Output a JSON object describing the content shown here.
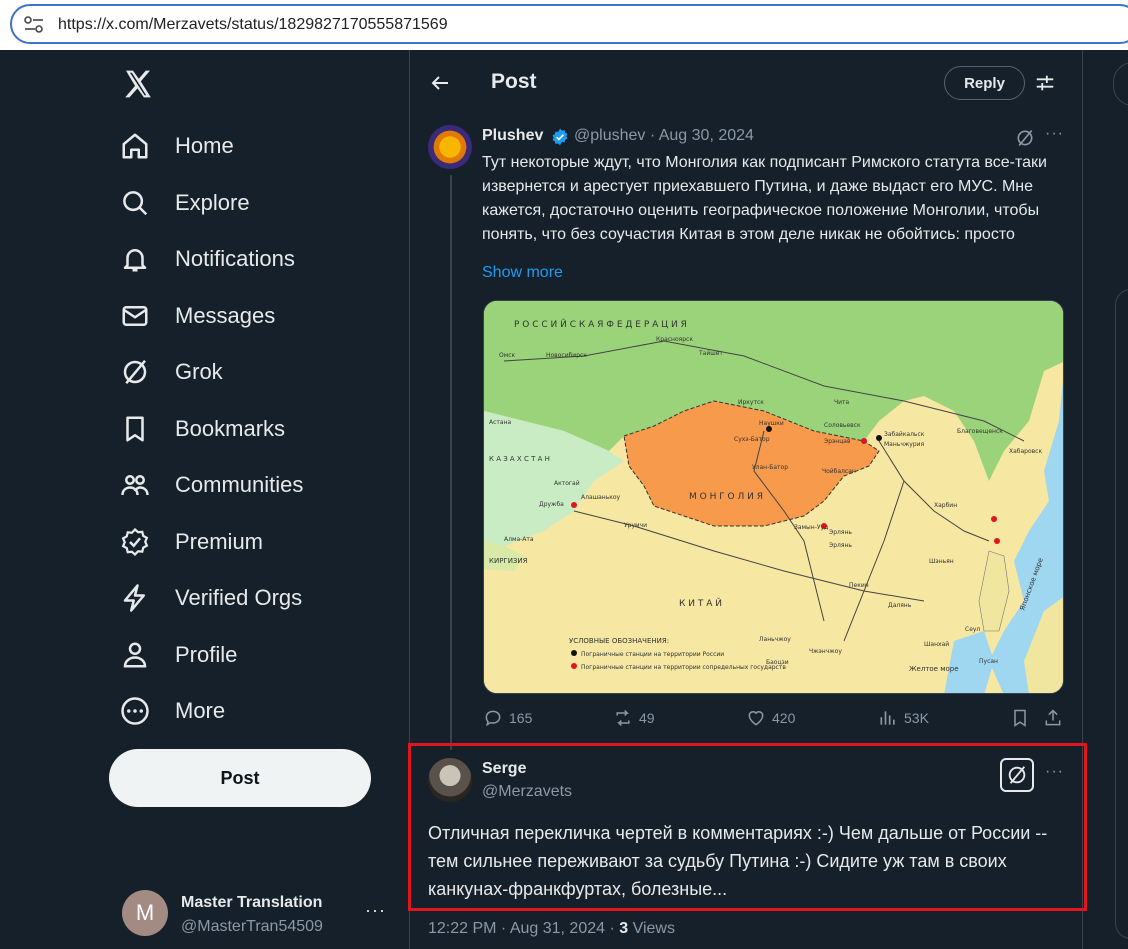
{
  "browser": {
    "url": "https://x.com/Merzavets/status/1829827170555871569"
  },
  "sidebar": {
    "items": [
      {
        "label": "Home",
        "icon": "home-icon"
      },
      {
        "label": "Explore",
        "icon": "search-icon"
      },
      {
        "label": "Notifications",
        "icon": "bell-icon"
      },
      {
        "label": "Messages",
        "icon": "mail-icon"
      },
      {
        "label": "Grok",
        "icon": "grok-icon"
      },
      {
        "label": "Bookmarks",
        "icon": "bookmark-icon"
      },
      {
        "label": "Communities",
        "icon": "communities-icon"
      },
      {
        "label": "Premium",
        "icon": "premium-icon"
      },
      {
        "label": "Verified Orgs",
        "icon": "lightning-icon"
      },
      {
        "label": "Profile",
        "icon": "person-icon"
      },
      {
        "label": "More",
        "icon": "more-circle-icon"
      }
    ],
    "post_label": "Post",
    "account": {
      "initial": "M",
      "name": "Master Translation",
      "handle": "@MasterTran54509",
      "more": "···"
    }
  },
  "header": {
    "title": "Post",
    "reply_label": "Reply"
  },
  "tweet": {
    "name": "Plushev",
    "meta": "@plushev · Aug 30, 2024",
    "text": "Тут некоторые ждут, что Монголия как подписант Римского статута все-таки извернется и арестует приехавшего Путина, и даже выдаст его МУС. Мне кажется, достаточно оценить географическое положение Монголии, чтобы понять, что без соучастия Китая в этом деле никак не обойтись: просто",
    "show_more": "Show more",
    "more": "···",
    "stats": {
      "replies": "165",
      "reposts": "49",
      "likes": "420",
      "views": "53K"
    },
    "map": {
      "russia": "Р О С С И Й С К А Я   Ф Е Д Е Р А Ц И Я",
      "mongolia": "М О Н Г О Л И Я",
      "china": "К   И   Т   А   Й",
      "kazakhstan": "К А З А Х С Т А Н",
      "kyrgyzstan": "КИРГИЗИЯ",
      "japan_sea": "Японское море",
      "yellow_sea": "Желтое море",
      "cities": [
        "Омск",
        "Новосибирск",
        "Красноярск",
        "Тайшет",
        "Иркутск",
        "Чита",
        "Наушки",
        "Сухэ-Батор",
        "Соловьевск",
        "Эрэнцав",
        "Забайкальск",
        "Маньчжурия",
        "Улан-Батор",
        "Чойбалсан",
        "Замын-Ууд",
        "Эрлянь",
        "Хабаровск",
        "Благовещенск",
        "Астана",
        "Актогай",
        "Дружба",
        "Алашанькоу",
        "Урумчи",
        "Алма-Ата",
        "Харбин",
        "Шэньян",
        "Пекин",
        "Далянь",
        "Сеул",
        "Пусан",
        "Ланьчжоу",
        "Баоцзи",
        "Чжэнчжоу",
        "Шанхай",
        "Эрлянь"
      ],
      "legend_title": "УСЛОВНЫЕ ОБОЗНАЧЕНИЯ:",
      "legend_1": "Пограничные станции на территории России",
      "legend_2": "Пограничные станции на территории сопредельных государств"
    }
  },
  "reply": {
    "name": "Serge",
    "handle": "@Merzavets",
    "more": "···",
    "text": "Отличная перекличка чертей в комментариях :-) Чем дальше от России -- тем сильнее переживают за судьбу Путина :-) Сидите уж там в своих канкунах-франкфуртах, болезные...",
    "time": "12:22 PM · Aug 31, 2024 · ",
    "views_count": "3",
    "views_label": " Views"
  },
  "colors": {
    "background": "#15202b",
    "accent": "#1d9bf0",
    "highlight": "#e0151d"
  }
}
